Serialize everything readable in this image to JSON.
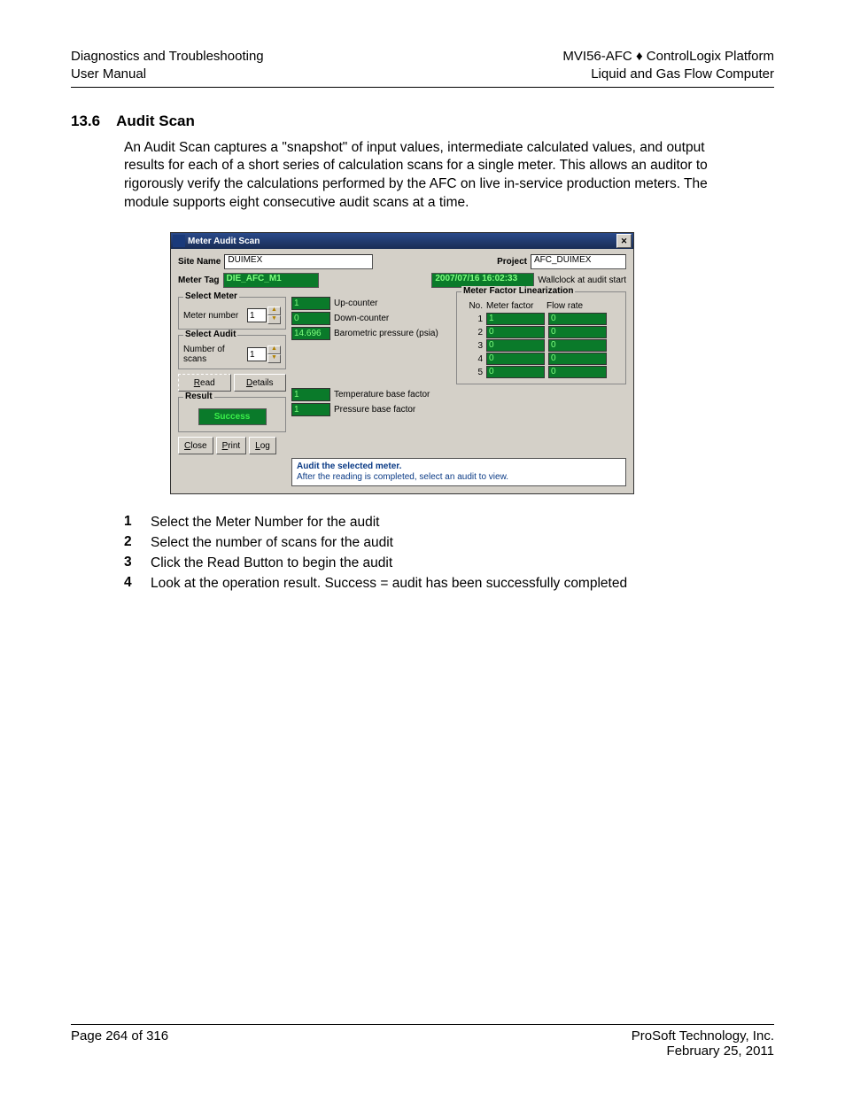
{
  "header": {
    "left1": "Diagnostics and Troubleshooting",
    "left2": "User Manual",
    "right1a": "MVI56-AFC",
    "diamond": "♦",
    "right1b": "ControlLogix Platform",
    "right2": "Liquid and Gas Flow Computer"
  },
  "section": {
    "num": "13.6",
    "title": "Audit Scan"
  },
  "para": "An Audit Scan captures a \"snapshot\" of input values, intermediate calculated values, and output results for each of a short series of calculation scans for a single meter. This allows an auditor to rigorously verify the calculations performed by the AFC on live in-service production meters. The module supports eight consecutive audit scans at a time.",
  "dlg": {
    "title": "Meter Audit Scan",
    "site_lbl": "Site Name",
    "site": "DUIMEX",
    "proj_lbl": "Project",
    "proj": "AFC_DUIMEX",
    "tag_lbl": "Meter Tag",
    "tag": "DIE_AFC_M1",
    "wall_ts": "2007/07/16 16:02:33",
    "wall_lbl": "Wallclock at audit start",
    "grp_meter": "Select Meter",
    "meter_num_lbl": "Meter number",
    "meter_num": "1",
    "grp_audit": "Select Audit",
    "num_scans_lbl": "Number of scans",
    "num_scans": "1",
    "btn_read": "Read",
    "btn_details": "Details",
    "grp_result": "Result",
    "success": "Success",
    "btn_close": "Close",
    "btn_print": "Print",
    "btn_log": "Log",
    "mid": [
      {
        "v": "1",
        "t": "Up-counter"
      },
      {
        "v": "0",
        "t": "Down-counter"
      },
      {
        "v": "14.696",
        "t": "Barometric pressure (psia)"
      }
    ],
    "mid2": [
      {
        "v": "1",
        "t": "Temperature base factor"
      },
      {
        "v": "1",
        "t": "Pressure base factor"
      }
    ],
    "lin_title": "Meter Factor Linearization",
    "lin_hdr": {
      "c1": "No.",
      "c2": "Meter factor",
      "c3": "Flow rate"
    },
    "lin": [
      {
        "n": "1",
        "mf": "1",
        "fr": "0"
      },
      {
        "n": "2",
        "mf": "0",
        "fr": "0"
      },
      {
        "n": "3",
        "mf": "0",
        "fr": "0"
      },
      {
        "n": "4",
        "mf": "0",
        "fr": "0"
      },
      {
        "n": "5",
        "mf": "0",
        "fr": "0"
      }
    ],
    "help1": "Audit the selected meter.",
    "help2": "After the reading is completed, select an audit to view."
  },
  "steps": [
    {
      "n": "1",
      "t": "Select the Meter Number for the audit"
    },
    {
      "n": "2",
      "t": "Select the number of scans for the audit"
    },
    {
      "n": "3",
      "t": "Click the Read Button to begin the audit"
    },
    {
      "n": "4",
      "t": "Look at the operation result. Success  =  audit has been  successfully completed"
    }
  ],
  "footer": {
    "page": "Page 264 of 316",
    "company": "ProSoft Technology, Inc.",
    "date": "February 25, 2011"
  }
}
